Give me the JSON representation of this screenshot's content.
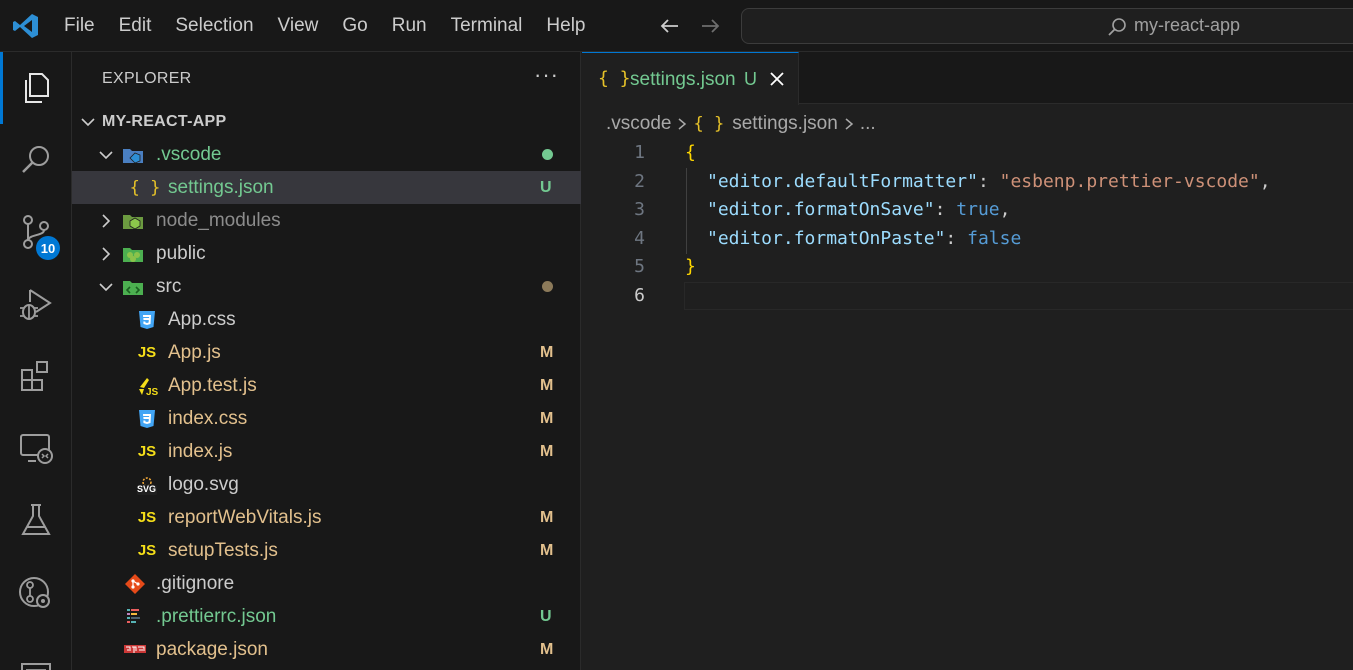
{
  "menu": [
    "File",
    "Edit",
    "Selection",
    "View",
    "Go",
    "Run",
    "Terminal",
    "Help"
  ],
  "command_center": {
    "text": "my-react-app"
  },
  "activity_bar": {
    "items": [
      "explorer-icon",
      "search-icon",
      "source-control-icon",
      "run-debug-icon",
      "extensions-icon",
      "remote-explorer-icon",
      "testing-icon",
      "git-graph-icon",
      "panel-icon"
    ],
    "source_control_badge": "10"
  },
  "explorer": {
    "title": "EXPLORER",
    "more": "···",
    "root": "MY-REACT-APP",
    "rows": [
      {
        "name": "vscode-folder",
        "label": ".vscode",
        "status": "dot",
        "color": "#73c991"
      },
      {
        "name": "settings-json",
        "label": "settings.json",
        "status": "U",
        "color": "#73c991"
      },
      {
        "name": "node-modules-folder",
        "label": "node_modules",
        "status": "",
        "color": "#8c8c8c"
      },
      {
        "name": "public-folder",
        "label": "public",
        "status": "",
        "color": "#cccccc"
      },
      {
        "name": "src-folder",
        "label": "src",
        "status": "dot",
        "color": "#cccccc"
      },
      {
        "name": "app-css",
        "label": "App.css",
        "status": "",
        "color": "#cccccc"
      },
      {
        "name": "app-js",
        "label": "App.js",
        "status": "M",
        "color": "#e2c08d"
      },
      {
        "name": "app-test-js",
        "label": "App.test.js",
        "status": "M",
        "color": "#e2c08d"
      },
      {
        "name": "index-css",
        "label": "index.css",
        "status": "M",
        "color": "#e2c08d"
      },
      {
        "name": "index-js",
        "label": "index.js",
        "status": "M",
        "color": "#e2c08d"
      },
      {
        "name": "logo-svg",
        "label": "logo.svg",
        "status": "",
        "color": "#cccccc"
      },
      {
        "name": "report-web-vitals-js",
        "label": "reportWebVitals.js",
        "status": "M",
        "color": "#e2c08d"
      },
      {
        "name": "setup-tests-js",
        "label": "setupTests.js",
        "status": "M",
        "color": "#e2c08d"
      },
      {
        "name": "gitignore",
        "label": ".gitignore",
        "status": "",
        "color": "#cccccc"
      },
      {
        "name": "prettierrc-json",
        "label": ".prettierrc.json",
        "status": "U",
        "color": "#73c991"
      },
      {
        "name": "package-json",
        "label": "package.json",
        "status": "M",
        "color": "#e2c08d"
      }
    ],
    "icon_text": {
      "js": "JS",
      "json": "{ }",
      "svg": "SVG"
    }
  },
  "editor": {
    "tab": {
      "icon": "{ }",
      "label": "settings.json",
      "status": "U"
    },
    "breadcrumb": {
      "folder": ".vscode",
      "icon": "{ }",
      "file": "settings.json",
      "more": "..."
    },
    "line_numbers": [
      "1",
      "2",
      "3",
      "4",
      "5",
      "6"
    ],
    "lines": [
      {
        "open": "{"
      },
      {
        "key": "\"editor.defaultFormatter\"",
        "colon": ": ",
        "value": "\"esbenp.prettier-vscode\"",
        "comma": ","
      },
      {
        "key": "\"editor.formatOnSave\"",
        "colon": ": ",
        "value": "true",
        "comma": ","
      },
      {
        "key": "\"editor.formatOnPaste\"",
        "colon": ": ",
        "value": "false",
        "comma": ""
      },
      {
        "close": "}"
      },
      {
        "empty": ""
      }
    ]
  },
  "colors": {
    "accent": "#0078d4",
    "untracked": "#73c991",
    "modified": "#e2c08d"
  }
}
